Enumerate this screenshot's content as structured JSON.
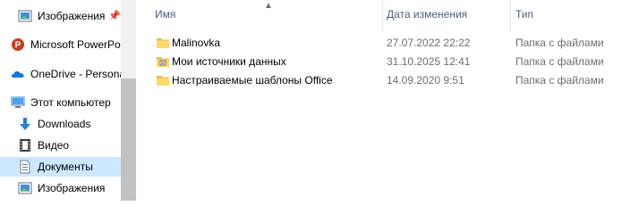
{
  "nav": {
    "items": [
      {
        "label": "Изображения",
        "icon": "pictures-icon",
        "pinned": true
      },
      {
        "label": "Microsoft PowerPo",
        "icon": "powerpoint-icon"
      },
      {
        "label": "OneDrive - Persona",
        "icon": "onedrive-icon"
      },
      {
        "label": "Этот компьютер",
        "icon": "this-pc-icon"
      },
      {
        "label": "Downloads",
        "icon": "downloads-icon"
      },
      {
        "label": "Видео",
        "icon": "videos-icon"
      },
      {
        "label": "Документы",
        "icon": "documents-icon",
        "selected": true
      },
      {
        "label": "Изображения",
        "icon": "pictures-icon"
      }
    ],
    "pin_glyph": "📌"
  },
  "columns": {
    "name": "Имя",
    "date": "Дата изменения",
    "type": "Тип"
  },
  "files": [
    {
      "name": "Malinovka",
      "date": "27.07.2022 22:22",
      "type": "Папка с файлами",
      "icon": "folder-icon"
    },
    {
      "name": "Мои источники данных",
      "date": "31.10.2025 12:41",
      "type": "Папка с файлами",
      "icon": "data-sources-folder-icon"
    },
    {
      "name": "Настраиваемые шаблоны Office",
      "date": "14.09.2020 9:51",
      "type": "Папка с файлами",
      "icon": "folder-icon"
    }
  ],
  "colors": {
    "selected": "#cce8ff",
    "folder": "#ffd76a",
    "header_text": "#4c607a",
    "secondary_text": "#6d6d6d"
  }
}
